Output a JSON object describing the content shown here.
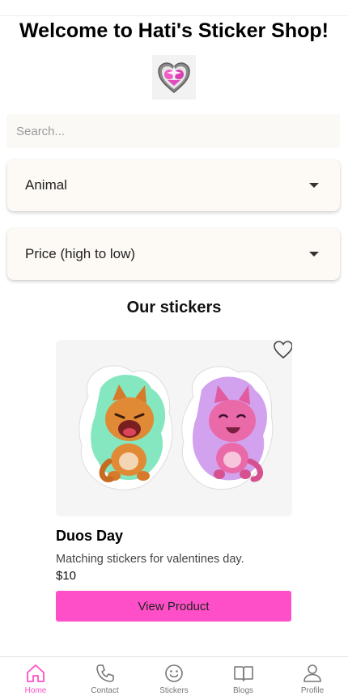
{
  "header": {
    "title": "Welcome to Hati's Sticker Shop!"
  },
  "search": {
    "placeholder": "Search...",
    "value": ""
  },
  "filters": {
    "category": "Animal",
    "sort": "Price (high to low)"
  },
  "section": {
    "heading": "Our stickers"
  },
  "products": [
    {
      "title": "Duos Day",
      "description": "Matching stickers for valentines day.",
      "price": "$10",
      "button_label": "View Product"
    }
  ],
  "nav": {
    "items": [
      {
        "label": "Home",
        "icon": "home-icon",
        "active": true
      },
      {
        "label": "Contact",
        "icon": "phone-icon",
        "active": false
      },
      {
        "label": "Stickers",
        "icon": "smiley-icon",
        "active": false
      },
      {
        "label": "Blogs",
        "icon": "book-icon",
        "active": false
      },
      {
        "label": "Profile",
        "icon": "person-icon",
        "active": false
      }
    ]
  },
  "colors": {
    "accent": "#ff4fc8",
    "inactive": "#777777"
  }
}
